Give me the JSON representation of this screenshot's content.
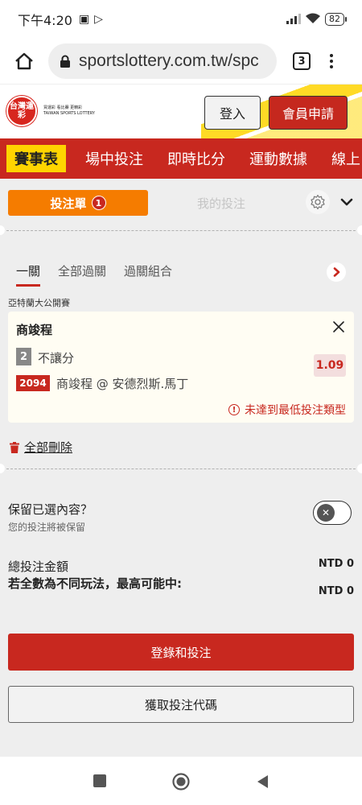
{
  "status_bar": {
    "time": "下午4:20",
    "battery": "82"
  },
  "browser": {
    "url": "sportslottery.com.tw/spc",
    "tab_count": "3"
  },
  "site_header": {
    "logo_text": "台灣運彩",
    "logo_subtitle_line1": "買運彩 看比賽 更精彩",
    "logo_subtitle_line2": "TAIWAN SPORTS LOTTERY",
    "login_label": "登入",
    "register_label": "會員申請"
  },
  "nav": {
    "items": [
      {
        "label": "賽事表",
        "active": true
      },
      {
        "label": "場中投注"
      },
      {
        "label": "即時比分"
      },
      {
        "label": "運動數據"
      },
      {
        "label": "線上"
      }
    ]
  },
  "betslip": {
    "tab_label": "投注單",
    "tab_badge": "1",
    "mybets_label": "我的投注",
    "subtabs": [
      {
        "label": "一關",
        "active": true
      },
      {
        "label": "全部過關"
      },
      {
        "label": "過關組合"
      }
    ],
    "league": "亞特蘭大公開賽",
    "selection": {
      "title": "商竣程",
      "number": "2",
      "bet_type": "不讓分",
      "odds": "1.09",
      "code": "2094",
      "match": "商竣程 @ 安德烈斯.馬丁",
      "warning": "未達到最低投注類型"
    },
    "delete_all": "全部刪除",
    "keep": {
      "title": "保留已選內容？",
      "subtitle": "您的投注將被保留",
      "enabled": false
    },
    "total_label": "總投注金額",
    "total_value": "NTD 0",
    "maxwin_label": "若全數為不同玩法，最高可能中:",
    "maxwin_value": "NTD 0",
    "login_bet_button": "登錄和投注",
    "get_code_button": "獲取投注代碼"
  },
  "colors": {
    "brand_red": "#c8281f",
    "accent_orange": "#f57c00",
    "accent_yellow": "#ffd400"
  }
}
